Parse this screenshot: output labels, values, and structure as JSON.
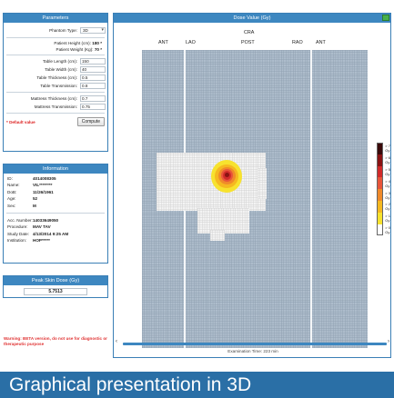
{
  "parameters": {
    "title": "Parameters",
    "phantom_type_label": "Phantom Type:",
    "phantom_type_value": "3D",
    "patient_height_label": "Patient Height (cm):",
    "patient_height_value": "180 *",
    "patient_weight_label": "Patient Weight (Kg):",
    "patient_weight_value": "70 *",
    "table_length_label": "Table Length (cm):",
    "table_length_value": "150",
    "table_width_label": "Table Width (cm):",
    "table_width_value": "40",
    "table_thickness_label": "Table Thickness (cm):",
    "table_thickness_value": "0.5",
    "table_transmission_label": "Table Transmission:",
    "table_transmission_value": "0.8",
    "mattress_thickness_label": "Mattress Thickness (cm):",
    "mattress_thickness_value": "0.7",
    "mattress_transmission_label": "Mattress Transmission:",
    "mattress_transmission_value": "0.75",
    "default_value_label": "* Default value",
    "compute_label": "Compute"
  },
  "information": {
    "title": "Information",
    "rows": [
      {
        "label": "ID:",
        "value": "4014008305"
      },
      {
        "label": "Name:",
        "value": "VIL********"
      },
      {
        "label": "DoB:",
        "value": "11/26/1961"
      },
      {
        "label": "Age:",
        "value": "52"
      },
      {
        "label": "Sex:",
        "value": "M"
      }
    ],
    "rows2": [
      {
        "label": "Acc. Number:",
        "value": "14033649050"
      },
      {
        "label": "Procedure:",
        "value": "MAV TAV"
      },
      {
        "label": "Study Date:",
        "value": "4/13/2014 9:25 AM"
      },
      {
        "label": "Institution:",
        "value": "HOP*****"
      }
    ]
  },
  "peak_skin_dose": {
    "title": "Peak Skin Dose (Gy)",
    "value": "5.7513"
  },
  "warning": "Warning: BETA version, do not use for diagnostic or therapeutic purpose",
  "main": {
    "title": "Dose Value (Gy)",
    "cra_label": "CRA",
    "view_labels": [
      "ANT",
      "LAO",
      "POST",
      "RAO",
      "ANT"
    ],
    "exam_time": "Examination Time: 223 min"
  },
  "legend": [
    {
      "label": "> 7 Gy",
      "color": "#3b0a0a"
    },
    {
      "label": "> 6 Gy",
      "color": "#8a1313"
    },
    {
      "label": "> 5 Gy",
      "color": "#d12a2a"
    },
    {
      "label": "> 4 Gy",
      "color": "#e8553a"
    },
    {
      "label": "> 3 Gy",
      "color": "#f08a2a"
    },
    {
      "label": "> 2 Gy",
      "color": "#f5b820"
    },
    {
      "label": "> 1 Gy",
      "color": "#f7e22e"
    },
    {
      "label": "> 0 Gy",
      "color": "#ffffff"
    }
  ],
  "banner": "Graphical presentation in 3D"
}
